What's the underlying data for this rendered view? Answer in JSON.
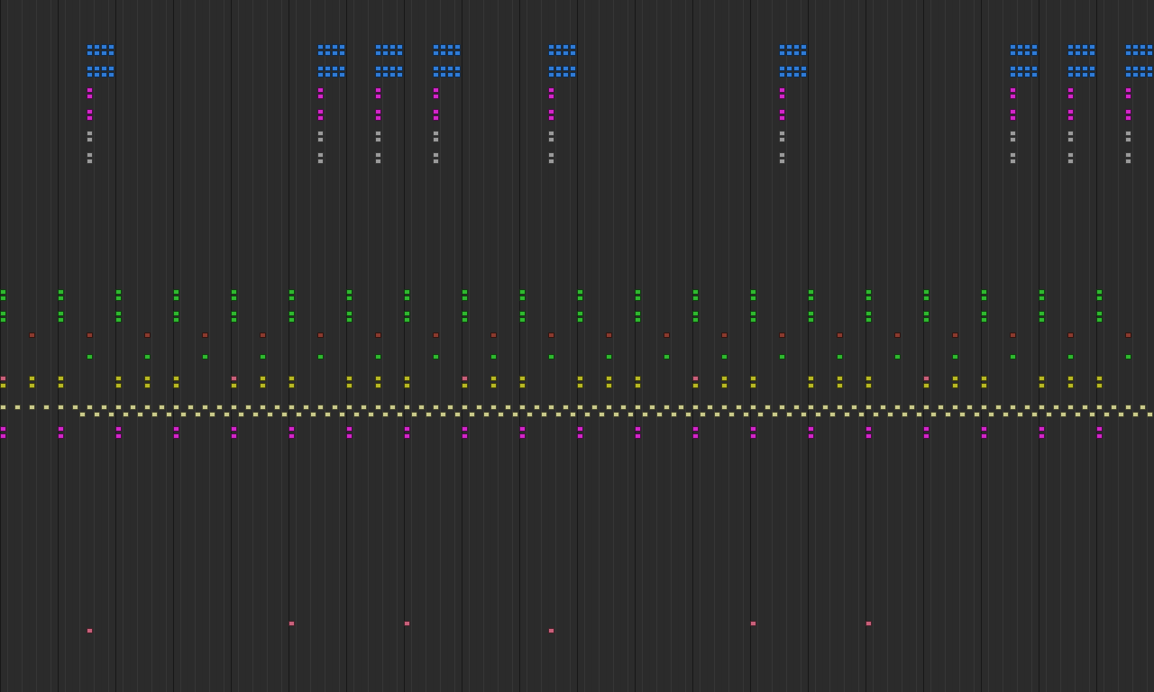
{
  "editor": {
    "view": "piano-roll",
    "background_color": "#2b2b2b",
    "grid_line_color": "#1f1f1f"
  },
  "track_colors": {
    "blue": "#2f7bd6",
    "magenta": "#d226c8",
    "white": "#9a9a9a",
    "green": "#2fb82f",
    "red": "#8a3a2e",
    "olive": "#b8b824",
    "khaki": "#c9c98a",
    "pink": "#c8607a"
  }
}
